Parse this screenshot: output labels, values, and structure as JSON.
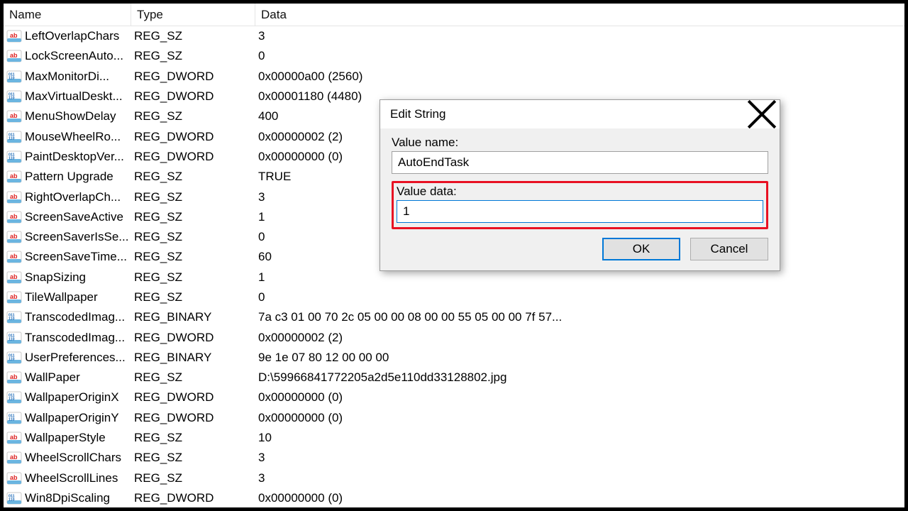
{
  "columns": {
    "name": "Name",
    "type": "Type",
    "data": "Data"
  },
  "types": {
    "sz": "REG_SZ",
    "dword": "REG_DWORD",
    "binary": "REG_BINARY"
  },
  "rows": [
    {
      "icon": "ab",
      "name": "LeftOverlapChars",
      "type_key": "sz",
      "data": "3"
    },
    {
      "icon": "ab",
      "name": "LockScreenAuto...",
      "type_key": "sz",
      "data": "0"
    },
    {
      "icon": "num",
      "name": "MaxMonitorDi...",
      "type_key": "dword",
      "data": "0x00000a00 (2560)"
    },
    {
      "icon": "num",
      "name": "MaxVirtualDeskt...",
      "type_key": "dword",
      "data": "0x00001180 (4480)"
    },
    {
      "icon": "ab",
      "name": "MenuShowDelay",
      "type_key": "sz",
      "data": "400"
    },
    {
      "icon": "num",
      "name": "MouseWheelRo...",
      "type_key": "dword",
      "data": "0x00000002 (2)"
    },
    {
      "icon": "num",
      "name": "PaintDesktopVer...",
      "type_key": "dword",
      "data": "0x00000000 (0)"
    },
    {
      "icon": "ab",
      "name": "Pattern Upgrade",
      "type_key": "sz",
      "data": "TRUE"
    },
    {
      "icon": "ab",
      "name": "RightOverlapCh...",
      "type_key": "sz",
      "data": "3"
    },
    {
      "icon": "ab",
      "name": "ScreenSaveActive",
      "type_key": "sz",
      "data": "1"
    },
    {
      "icon": "ab",
      "name": "ScreenSaverIsSe...",
      "type_key": "sz",
      "data": "0"
    },
    {
      "icon": "ab",
      "name": "ScreenSaveTime...",
      "type_key": "sz",
      "data": "60"
    },
    {
      "icon": "ab",
      "name": "SnapSizing",
      "type_key": "sz",
      "data": "1"
    },
    {
      "icon": "ab",
      "name": "TileWallpaper",
      "type_key": "sz",
      "data": "0"
    },
    {
      "icon": "num",
      "name": "TranscodedImag...",
      "type_key": "binary",
      "data": "7a c3 01 00 70 2c 05 00 00 08 00 00 55 05 00 00 7f 57..."
    },
    {
      "icon": "num",
      "name": "TranscodedImag...",
      "type_key": "dword",
      "data": "0x00000002 (2)"
    },
    {
      "icon": "num",
      "name": "UserPreferences...",
      "type_key": "binary",
      "data": "9e 1e 07 80 12 00 00 00"
    },
    {
      "icon": "ab",
      "name": "WallPaper",
      "type_key": "sz",
      "data": "D:\\59966841772205a2d5e110dd33128802.jpg"
    },
    {
      "icon": "num",
      "name": "WallpaperOriginX",
      "type_key": "dword",
      "data": "0x00000000 (0)"
    },
    {
      "icon": "num",
      "name": "WallpaperOriginY",
      "type_key": "dword",
      "data": "0x00000000 (0)"
    },
    {
      "icon": "ab",
      "name": "WallpaperStyle",
      "type_key": "sz",
      "data": "10"
    },
    {
      "icon": "ab",
      "name": "WheelScrollChars",
      "type_key": "sz",
      "data": "3"
    },
    {
      "icon": "ab",
      "name": "WheelScrollLines",
      "type_key": "sz",
      "data": "3"
    },
    {
      "icon": "num",
      "name": "Win8DpiScaling",
      "type_key": "dword",
      "data": "0x00000000 (0)"
    }
  ],
  "dialog": {
    "title": "Edit String",
    "value_name_label": "Value name:",
    "value_name": "AutoEndTask",
    "value_data_label": "Value data:",
    "value_data": "1",
    "ok": "OK",
    "cancel": "Cancel"
  }
}
